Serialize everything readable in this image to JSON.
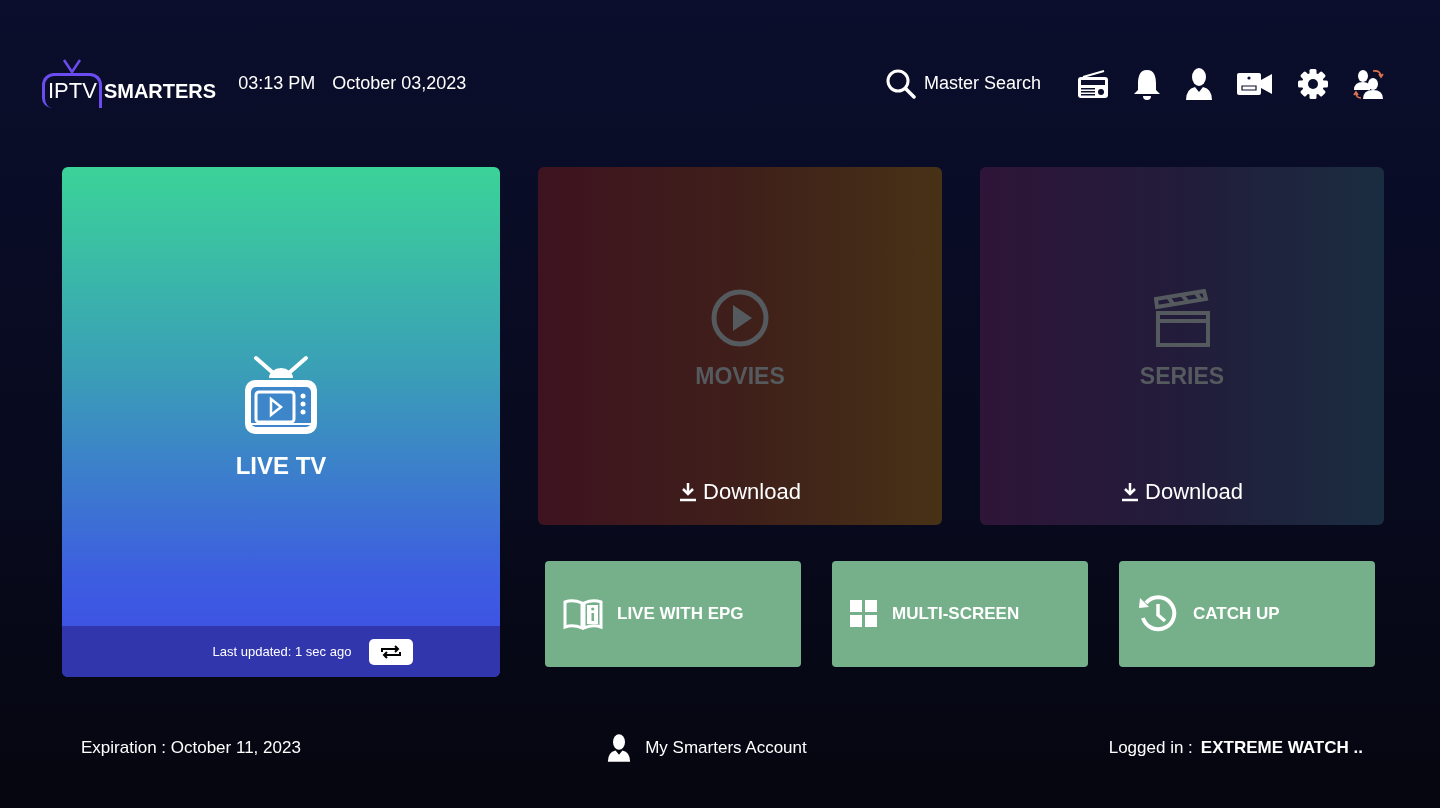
{
  "header": {
    "logo": {
      "light": "IPTV",
      "bold": "SMARTERS"
    },
    "time": "03:13 PM",
    "date": "October 03,2023",
    "search": {
      "label": "Master Search"
    }
  },
  "cards": [
    {
      "kind": "live",
      "title": "LIVE TV",
      "dimmed": false,
      "status": "Last updated: 1 sec ago"
    },
    {
      "kind": "download",
      "title": "MOVIES",
      "dimmed": true,
      "action": "Download"
    },
    {
      "kind": "download",
      "title": "SERIES",
      "dimmed": true,
      "action": "Download"
    }
  ],
  "tiles": [
    {
      "label": "LIVE WITH EPG"
    },
    {
      "label": "MULTI-SCREEN"
    },
    {
      "label": "CATCH UP"
    }
  ],
  "footer": {
    "expiration": "Expiration : October 11, 2023",
    "account": "My Smarters Account",
    "logged_label": "Logged in :",
    "logged_user": "EXTREME WATCH .."
  }
}
